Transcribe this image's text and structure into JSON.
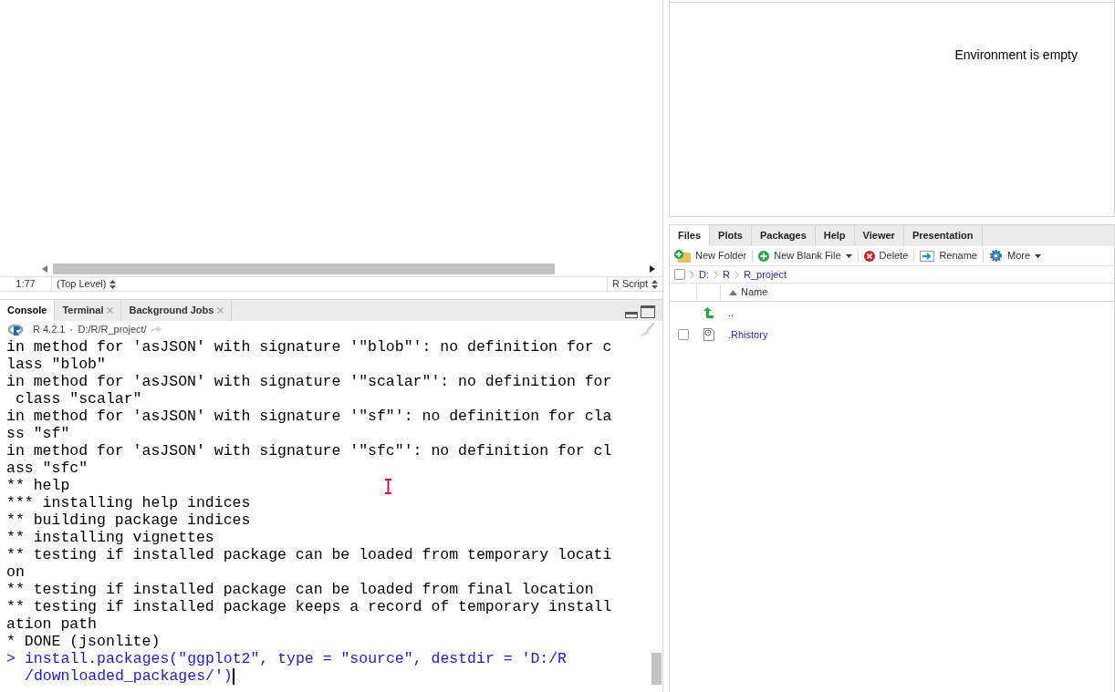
{
  "editor": {
    "status_bar": {
      "position": "1:77",
      "scope": "(Top Level)",
      "file_type": "R Script"
    }
  },
  "console": {
    "tabs": [
      {
        "label": "Console",
        "selected": true,
        "closable": false
      },
      {
        "label": "Terminal",
        "selected": false,
        "closable": true
      },
      {
        "label": "Background Jobs",
        "selected": false,
        "closable": true
      }
    ],
    "version": "R 4.2.1",
    "path": "D:/R/R_project/",
    "lines": [
      {
        "kind": "output",
        "text": "in method for 'asJSON' with signature '\"blob\"': no definition for c"
      },
      {
        "kind": "output",
        "text": "lass \"blob\""
      },
      {
        "kind": "output",
        "text": "in method for 'asJSON' with signature '\"scalar\"': no definition for"
      },
      {
        "kind": "output",
        "text": " class \"scalar\""
      },
      {
        "kind": "output",
        "text": "in method for 'asJSON' with signature '\"sf\"': no definition for cla"
      },
      {
        "kind": "output",
        "text": "ss \"sf\""
      },
      {
        "kind": "output",
        "text": "in method for 'asJSON' with signature '\"sfc\"': no definition for cl"
      },
      {
        "kind": "output",
        "text": "ass \"sfc\""
      },
      {
        "kind": "output",
        "text": "** help"
      },
      {
        "kind": "output",
        "text": "*** installing help indices"
      },
      {
        "kind": "output",
        "text": "** building package indices"
      },
      {
        "kind": "output",
        "text": "** installing vignettes"
      },
      {
        "kind": "output",
        "text": "** testing if installed package can be loaded from temporary locati"
      },
      {
        "kind": "output",
        "text": "on"
      },
      {
        "kind": "output",
        "text": "** testing if installed package can be loaded from final location"
      },
      {
        "kind": "output",
        "text": "** testing if installed package keeps a record of temporary install"
      },
      {
        "kind": "output",
        "text": "ation path"
      },
      {
        "kind": "output",
        "text": "* DONE (jsonlite)"
      },
      {
        "kind": "input",
        "prompt": ">",
        "text": "install.packages(\"ggplot2\", type = \"source\", destdir = 'D:/R"
      },
      {
        "kind": "continuation",
        "text": "/downloaded_packages/')"
      }
    ]
  },
  "environment": {
    "message": "Environment is empty"
  },
  "files": {
    "tabs": [
      {
        "label": "Files",
        "selected": true
      },
      {
        "label": "Plots",
        "selected": false
      },
      {
        "label": "Packages",
        "selected": false
      },
      {
        "label": "Help",
        "selected": false
      },
      {
        "label": "Viewer",
        "selected": false
      },
      {
        "label": "Presentation",
        "selected": false
      }
    ],
    "toolbar": [
      {
        "kind": "new-folder",
        "label": "New Folder",
        "menu": false
      },
      {
        "kind": "new-file",
        "label": "New Blank File",
        "menu": true
      },
      {
        "kind": "delete",
        "label": "Delete",
        "menu": false
      },
      {
        "kind": "rename",
        "label": "Rename",
        "menu": false
      },
      {
        "kind": "more",
        "label": "More",
        "menu": true
      }
    ],
    "select_all": {
      "checked": false
    },
    "breadcrumb": [
      "D:",
      "R",
      "R_project"
    ],
    "column": "Name",
    "rows": [
      {
        "kind": "parent",
        "name": ".."
      },
      {
        "kind": "file",
        "name": ".Rhistory",
        "checked": false
      }
    ]
  }
}
